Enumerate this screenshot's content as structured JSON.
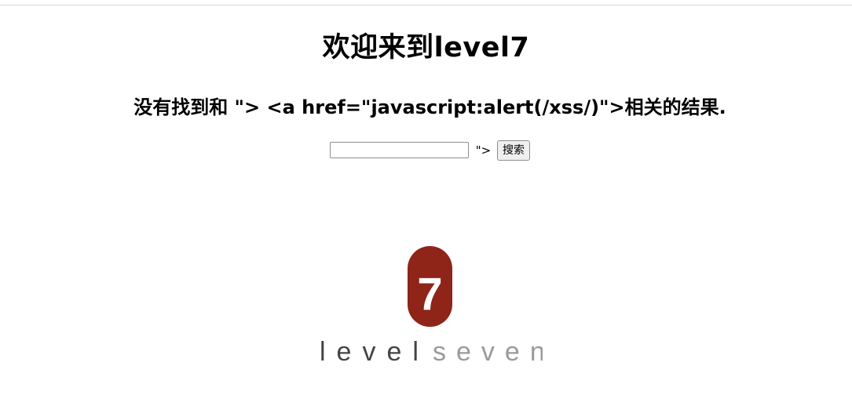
{
  "page": {
    "title": "欢迎来到level7",
    "result_message": "没有找到和 \"> <a href=\"javascript:alert(/xss/)\">相关的结果.",
    "search": {
      "input_value": "",
      "suffix_text": "\">",
      "button_label": "搜索"
    }
  },
  "logo": {
    "number": "7",
    "word_dark": "level",
    "word_light": "seven",
    "badge_color": "#8f2419",
    "dark_text_color": "#444444",
    "light_text_color": "#9a9a9a"
  }
}
